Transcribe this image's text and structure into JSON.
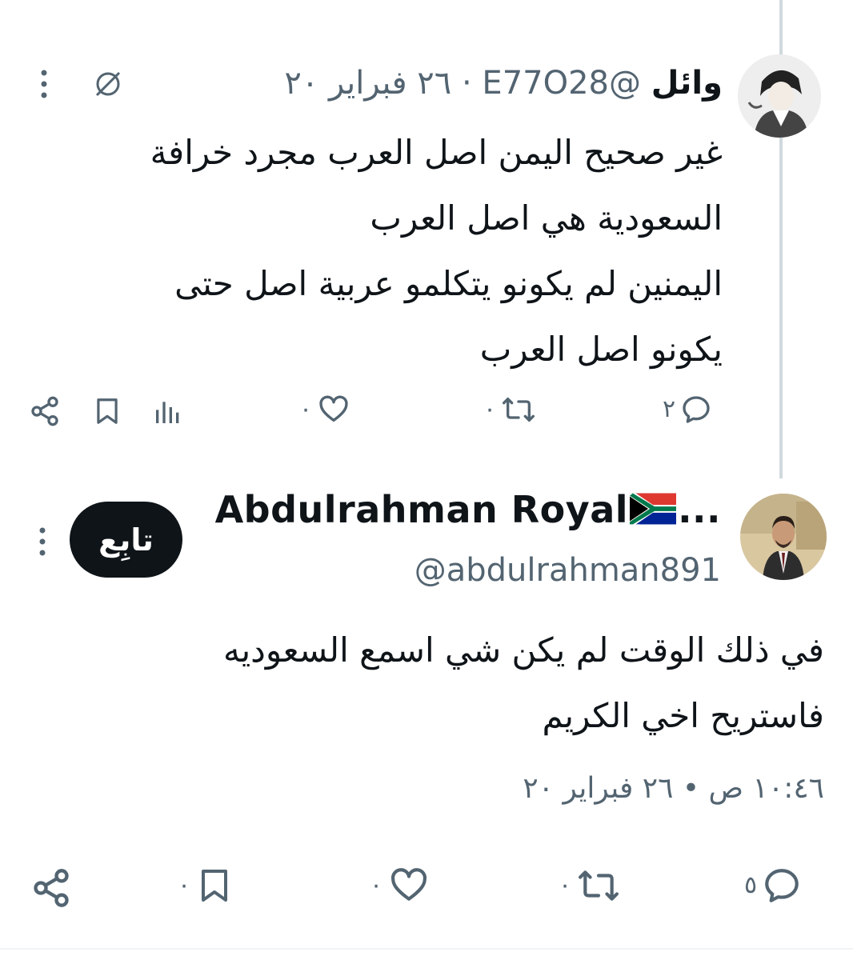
{
  "tweet1": {
    "display_name": "وائل",
    "handle": "@E77O28",
    "separator": "·",
    "date": "٢٦ فبراير ٢٠",
    "body_lines": [
      "غير صحيح اليمن اصل العرب مجرد خرافة",
      "السعودية هي اصل العرب",
      "اليمنين لم يكونو يتكلمو عربية اصل حتى",
      "يكونو اصل العرب"
    ],
    "actions": {
      "reply_count": "٢",
      "retweet_count": "٠",
      "like_count": "٠"
    }
  },
  "tweet2": {
    "display_name": "Abdulrahman Royal",
    "name_ellipsis": "...",
    "handle": "@abdulrahman891",
    "follow_label": "تابِع",
    "body_lines": [
      "في ذلك الوقت لم يكن شي اسمع السعوديه",
      "فاستريح اخي الكريم"
    ],
    "timestamp_time": "١٠:٤٦ ص",
    "timestamp_separator": "•",
    "timestamp_date": "٢٦ فبراير ٢٠",
    "actions": {
      "reply_count": "٥",
      "retweet_count": "٠",
      "like_count": "٠",
      "bookmark_count": "٠"
    }
  },
  "icons": {
    "more": "more-vertical-icon",
    "grok": "grok-icon",
    "reply": "reply-icon",
    "retweet": "retweet-icon",
    "like": "heart-icon",
    "views": "analytics-icon",
    "bookmark": "bookmark-icon",
    "share": "share-icon",
    "flag": "south-africa-flag-icon"
  },
  "colors": {
    "text": "#0f1419",
    "secondary": "#536471",
    "thread_line": "#cfd9de",
    "follow_bg": "#0f1419"
  }
}
